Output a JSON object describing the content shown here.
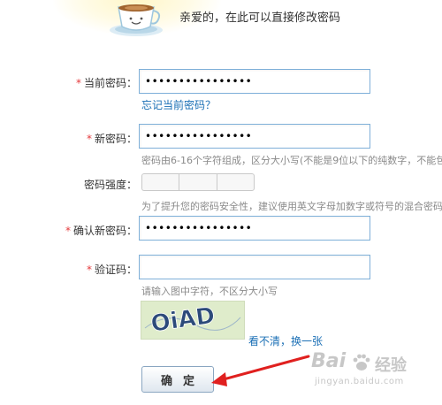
{
  "header": {
    "text": "亲爱的，在此可以直接修改密码",
    "icon": "coffee-cup-icon"
  },
  "form": {
    "current_password": {
      "label": "当前密码：",
      "required_mark": "*",
      "value": "••••••••••••••••",
      "forgot_link": "忘记当前密码？"
    },
    "new_password": {
      "label": "新密码：",
      "required_mark": "*",
      "value": "••••••••••••••••",
      "hint": "密码由6-16个字符组成，区分大小写(不能是9位以下的纯数字，不能包"
    },
    "strength": {
      "label": "密码强度：",
      "hint": "为了提升您的密码安全性，建议使用英文字母加数字或符号的混合密码"
    },
    "confirm_password": {
      "label": "确认新密码：",
      "required_mark": "*",
      "value": "••••••••••••••••"
    },
    "captcha": {
      "label": "验证码：",
      "required_mark": "*",
      "value": "",
      "hint": "请输入图中字符，不区分大小写",
      "image_text": "OiAD",
      "refresh_link": "看不清，换一张"
    },
    "submit_label": "确定"
  },
  "watermark": {
    "brand": "Bai",
    "brand_suffix": "经验",
    "url": "jingyan.baidu.com"
  },
  "colors": {
    "link": "#1a6fb5",
    "required": "#e4393c",
    "input_border": "#7fb0d9",
    "arrow": "#e0201f"
  }
}
